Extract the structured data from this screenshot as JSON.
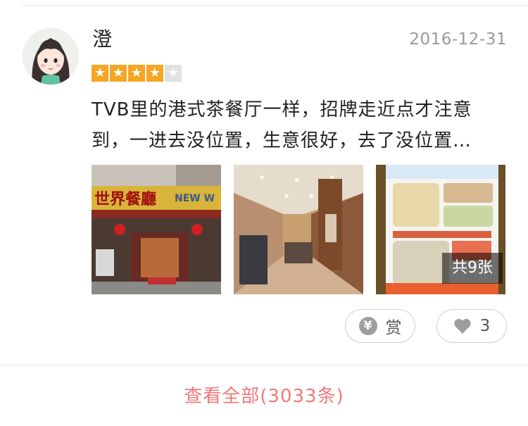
{
  "review": {
    "username": "澄",
    "date": "2016-12-31",
    "rating": 4,
    "rating_max": 5,
    "text_line1": "TVB里的港式茶餐厅一样，招牌走近点才注意",
    "text_line2": "到，一进去没位置，生意很好，去了没位置…",
    "photo_count_label": "共9张",
    "sign_text": "世界餐廳",
    "sign_text_en": "NEW W",
    "tip_label": "赏",
    "like_count": "3"
  },
  "footer": {
    "view_all_label": "查看全部(3033条)"
  },
  "colors": {
    "star_on": "#f5a623",
    "star_off": "#e1e1e1",
    "link": "#f0787a"
  }
}
